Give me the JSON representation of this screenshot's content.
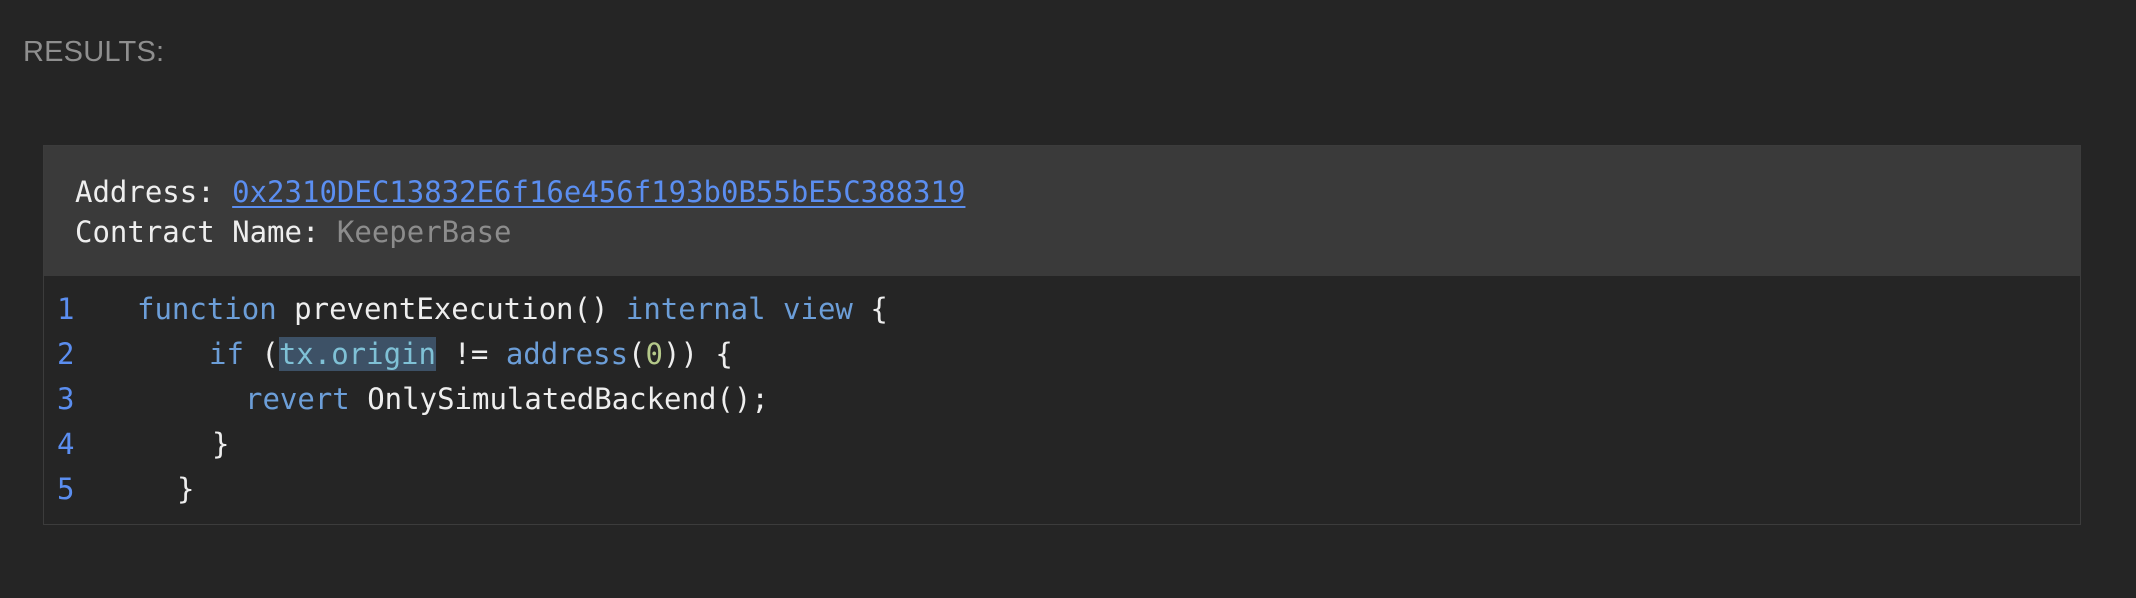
{
  "results_label": "RESULTS:",
  "header": {
    "address_label": "Address: ",
    "address_value": "0x2310DEC13832E6f16e456f193b0B55bE5C388319",
    "contract_name_label": "Contract Name: ",
    "contract_name_value": "KeeperBase"
  },
  "code": {
    "line_numbers": [
      "1",
      "2",
      "3",
      "4",
      "5"
    ],
    "line1": {
      "kw_function": "function",
      "name": " preventExecution() ",
      "kw_internal": "internal",
      "space": " ",
      "kw_view": "view",
      "open": " {"
    },
    "line2": {
      "kw_if": "if",
      "paren": " (",
      "highlight": "tx.origin",
      "neq": " != ",
      "kw_address": "address",
      "open_paren": "(",
      "zero": "0",
      "close": ")) {"
    },
    "line3": {
      "kw_revert": "revert",
      "rest": " OnlySimulatedBackend();"
    },
    "line4": {
      "brace": "}"
    },
    "line5": {
      "brace": "}"
    }
  },
  "colors": {
    "background": "#252525",
    "header_background": "#3a3a3a",
    "link": "#5b8ef0",
    "keyword": "#6c9ed8",
    "number": "#b5c98a",
    "highlight": "#3d5166"
  }
}
